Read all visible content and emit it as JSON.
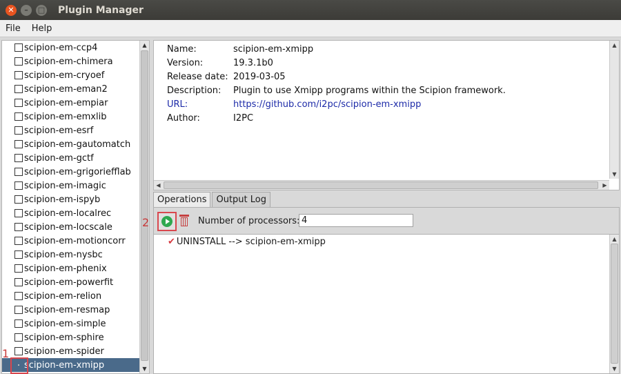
{
  "window": {
    "title": "Plugin Manager",
    "controls": [
      "close-icon",
      "minimize-icon",
      "maximize-icon"
    ]
  },
  "menu": {
    "items": [
      "File",
      "Help"
    ]
  },
  "plugins": [
    "scipion-em-ccp4",
    "scipion-em-chimera",
    "scipion-em-cryoef",
    "scipion-em-eman2",
    "scipion-em-empiar",
    "scipion-em-emxlib",
    "scipion-em-esrf",
    "scipion-em-gautomatch",
    "scipion-em-gctf",
    "scipion-em-grigoriefflab",
    "scipion-em-imagic",
    "scipion-em-ispyb",
    "scipion-em-localrec",
    "scipion-em-locscale",
    "scipion-em-motioncorr",
    "scipion-em-nysbc",
    "scipion-em-phenix",
    "scipion-em-powerfit",
    "scipion-em-relion",
    "scipion-em-resmap",
    "scipion-em-simple",
    "scipion-em-sphire",
    "scipion-em-spider",
    "scipion-em-xmipp"
  ],
  "selected_plugin_index": 23,
  "details": {
    "name_label": "Name:",
    "name": "scipion-em-xmipp",
    "version_label": "Version:",
    "version": "19.3.1b0",
    "release_label": "Release date:",
    "release_date": "2019-03-05",
    "description_label": "Description:",
    "description": "Plugin to use Xmipp programs within the Scipion framework.",
    "url_label": "URL:",
    "url": "https://github.com/i2pc/scipion-em-xmipp",
    "author_label": "Author:",
    "author": "I2PC"
  },
  "tabs": [
    "Operations",
    "Output Log"
  ],
  "active_tab": "Operations",
  "operations": {
    "processors_label": "Number of processors:",
    "processors_value": "4",
    "log": [
      "UNINSTALL --> scipion-em-xmipp"
    ]
  },
  "annotations": {
    "marker_1": "1",
    "marker_2": "2"
  },
  "colors": {
    "selection": "#4a6a8a",
    "link": "#1c2aa8",
    "annotation": "#d9474e",
    "run_green": "#2fa84f"
  }
}
